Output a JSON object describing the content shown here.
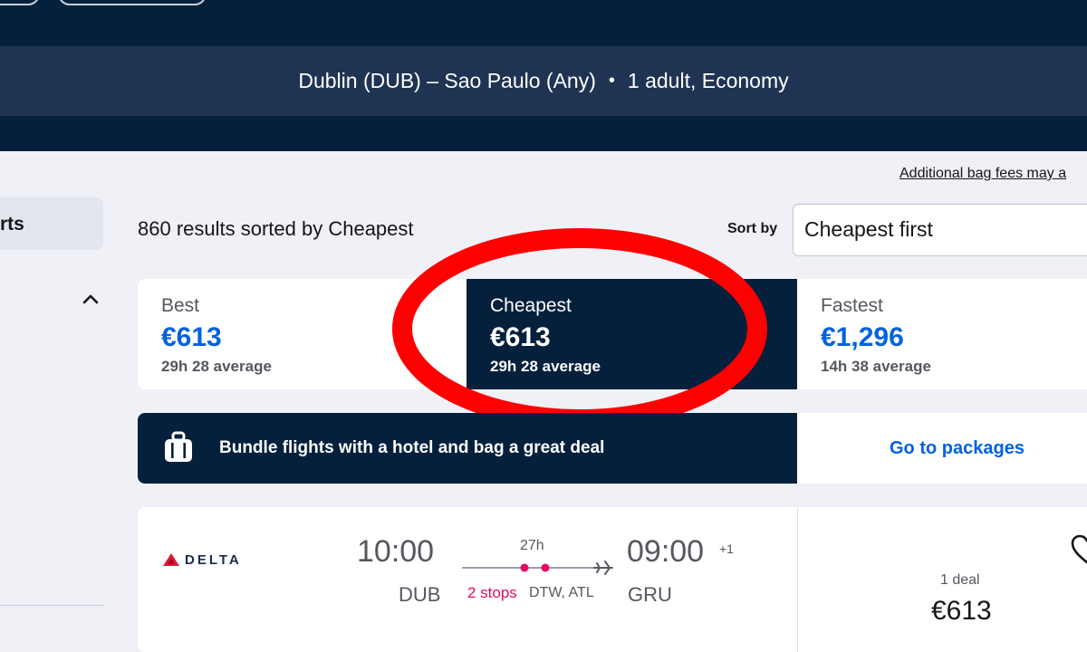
{
  "header": {
    "route": "Dublin (DUB) – Sao Paulo (Any)",
    "separator": "•",
    "passengers": "1 adult, Economy"
  },
  "sidebar": {
    "active_item": "rts"
  },
  "bag_fees_note": "Additional bag fees may a",
  "results": {
    "count_text": "860 results sorted by Cheapest",
    "sort_label": "Sort by",
    "sort_value": "Cheapest first"
  },
  "tabs": [
    {
      "label": "Best",
      "price": "€613",
      "average": "29h 28 average",
      "selected": false
    },
    {
      "label": "Cheapest",
      "price": "€613",
      "average": "29h 28 average",
      "selected": true
    },
    {
      "label": "Fastest",
      "price": "€1,296",
      "average": "14h 38 average",
      "selected": false
    }
  ],
  "bundle": {
    "text": "Bundle flights with a hotel and bag a great deal",
    "link": "Go to packages"
  },
  "flight": {
    "airline": "DELTA",
    "depart_time": "10:00",
    "depart_code": "DUB",
    "duration": "27h",
    "stops": "2 stops",
    "stop_codes": "DTW, ATL",
    "arrive_time": "09:00",
    "arrive_day_offset": "+1",
    "arrive_code": "GRU",
    "deal_count": "1 deal",
    "price": "€613"
  },
  "colors": {
    "navy": "#05203c",
    "search_bar": "#1f3452",
    "link_blue": "#0062e3",
    "stops_pink": "#e70866",
    "annotation_red": "#ff0000"
  },
  "icons": [
    "chevron-up-icon",
    "suitcase-icon",
    "plane-icon",
    "heart-icon",
    "delta-logo-icon"
  ]
}
